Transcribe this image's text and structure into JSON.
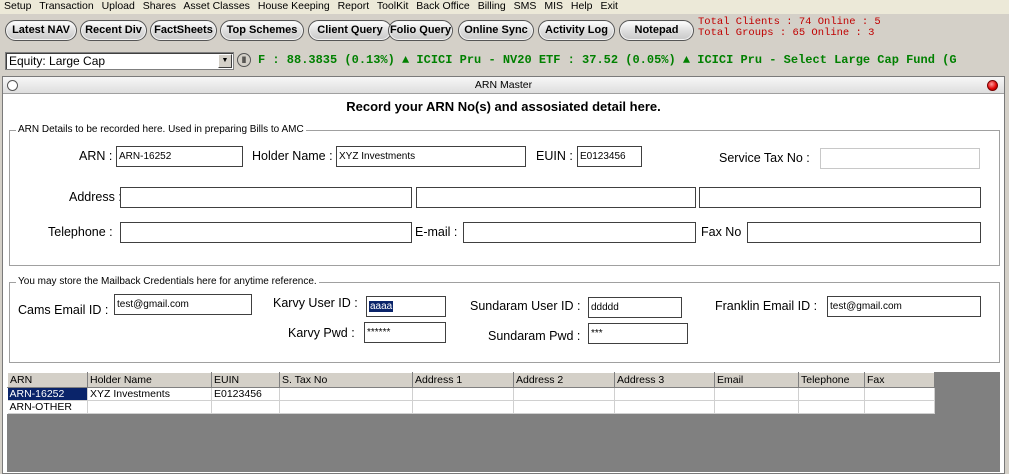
{
  "menu": [
    "Setup",
    "Transaction",
    "Upload",
    "Shares",
    "Asset Classes",
    "House Keeping",
    "Report",
    "ToolKit",
    "Back Office",
    "Billing",
    "SMS",
    "MIS",
    "Help",
    "Exit"
  ],
  "toolbar": {
    "buttons": [
      "Latest NAV",
      "Recent Div",
      "FactSheets",
      "Top Schemes",
      "Client Query",
      "Folio Query",
      "Online Sync",
      "Activity Log",
      "Notepad"
    ],
    "stats_line1": "Total Clients : 74 Online : 5",
    "stats_line2": "Total Groups : 65 Online : 3"
  },
  "ticker": {
    "category": "Equity: Large Cap",
    "text": "F : 88.3835 (0.13%) ▲  ICICI Pru - NV20 ETF : 37.52 (0.05%) ▲  ICICI Pru - Select Large Cap Fund (G"
  },
  "window": {
    "title": "ARN Master",
    "heading": "Record your ARN No(s) and assosiated detail here."
  },
  "arn_details": {
    "group_label": "ARN Details to be recorded here.  Used in preparing Bills to AMC",
    "arn_label": "ARN :",
    "arn_value": "ARN-16252",
    "holder_label": "Holder Name :",
    "holder_value": "XYZ Investments",
    "euin_label": "EUIN :",
    "euin_value": "E0123456",
    "stax_label": "Service Tax No :",
    "stax_value": "",
    "address_label": "Address :",
    "address1": "",
    "address2": "",
    "address3": "",
    "telephone_label": "Telephone :",
    "telephone_value": "",
    "email_label": "E-mail :",
    "email_value": "",
    "fax_label": "Fax No",
    "fax_value": ""
  },
  "mailback": {
    "group_label": "You may store the Mailback Credentials here for anytime reference.",
    "cams_label": "Cams Email ID :",
    "cams_value": "test@gmail.com",
    "karvy_user_label": "Karvy User ID :",
    "karvy_user_value": "aaaa",
    "karvy_pwd_label": "Karvy Pwd :",
    "karvy_pwd_value": "******",
    "sundaram_user_label": "Sundaram User ID :",
    "sundaram_user_value": "ddddd",
    "sundaram_pwd_label": "Sundaram Pwd :",
    "sundaram_pwd_value": "***",
    "franklin_label": "Franklin Email ID :",
    "franklin_value": "test@gmail.com"
  },
  "grid": {
    "columns": [
      "ARN",
      "Holder Name",
      "EUIN",
      "S. Tax No",
      "Address 1",
      "Address 2",
      "Address 3",
      "Email",
      "Telephone",
      "Fax"
    ],
    "rows": [
      [
        "ARN-16252",
        "XYZ Investments",
        "E0123456",
        "",
        "",
        "",
        "",
        "",
        "",
        ""
      ],
      [
        "ARN-OTHER",
        "",
        "",
        "",
        "",
        "",
        "",
        "",
        "",
        ""
      ]
    ]
  }
}
